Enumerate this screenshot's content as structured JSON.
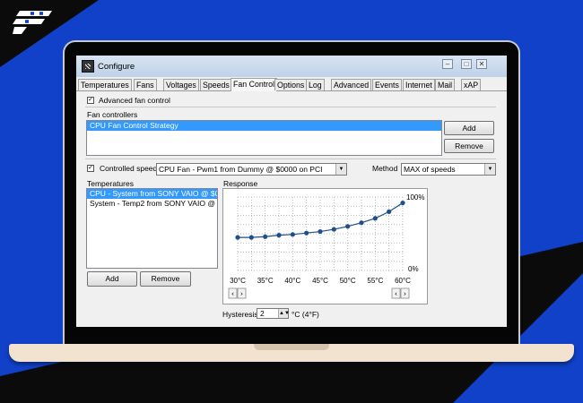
{
  "window": {
    "title": "Configure",
    "icon": "app-grid-icon",
    "controls": [
      "minimize-icon",
      "maximize-icon",
      "close-icon"
    ]
  },
  "tabs": [
    {
      "label": "Temperatures",
      "active": false
    },
    {
      "label": "Fans",
      "active": false
    },
    {
      "label": "Voltages",
      "active": false
    },
    {
      "label": "Speeds",
      "active": false
    },
    {
      "label": "Fan Control",
      "active": true
    },
    {
      "label": "Options",
      "active": false
    },
    {
      "label": "Log",
      "active": false
    },
    {
      "label": "Advanced",
      "active": false
    },
    {
      "label": "Events",
      "active": false
    },
    {
      "label": "Internet",
      "active": false
    },
    {
      "label": "Mail",
      "active": false
    },
    {
      "label": "xAP",
      "active": false
    }
  ],
  "advanced_fan_control": {
    "label": "Advanced fan control",
    "checked": true
  },
  "fan_controllers": {
    "label": "Fan controllers",
    "items": [
      {
        "label": "CPU Fan Control Strategy",
        "selected": true
      }
    ],
    "add_label": "Add",
    "remove_label": "Remove"
  },
  "controlled_speed": {
    "label": "Controlled speed",
    "checked": true,
    "value": "CPU Fan - Pwm1 from Dummy @ $0000 on PCI"
  },
  "method": {
    "label": "Method",
    "value": "MAX of speeds"
  },
  "temperatures": {
    "label": "Temperatures",
    "items": [
      {
        "label": "CPU - System from SONY VAIO @ $000",
        "selected": true
      },
      {
        "label": "System - Temp2 from SONY VAIO @ $0",
        "selected": false
      }
    ],
    "add_label": "Add",
    "remove_label": "Remove"
  },
  "response": {
    "label": "Response",
    "hysteresis_label": "Hysteresis",
    "hysteresis_value": "2",
    "hysteresis_unit": "°C (4°F)"
  },
  "chart_data": {
    "type": "line",
    "x_tick_labels": [
      "30°C",
      "35°C",
      "40°C",
      "45°C",
      "50°C",
      "55°C",
      "60°C"
    ],
    "y_tick_labels": {
      "top": "100%",
      "bottom": "0%"
    },
    "xlim": [
      30,
      60
    ],
    "ylim": [
      0,
      100
    ],
    "grid": true,
    "series": [
      {
        "x": [
          30,
          32.5,
          35,
          37.5,
          40,
          42.5,
          45,
          47.5,
          50,
          52.5,
          55,
          57.5,
          60
        ],
        "values": [
          45,
          45,
          46,
          48,
          49,
          51,
          53,
          56,
          60,
          65,
          71,
          80,
          92
        ]
      }
    ],
    "point_color": "#1f4f8a",
    "line_color": "#1f4f8a"
  }
}
